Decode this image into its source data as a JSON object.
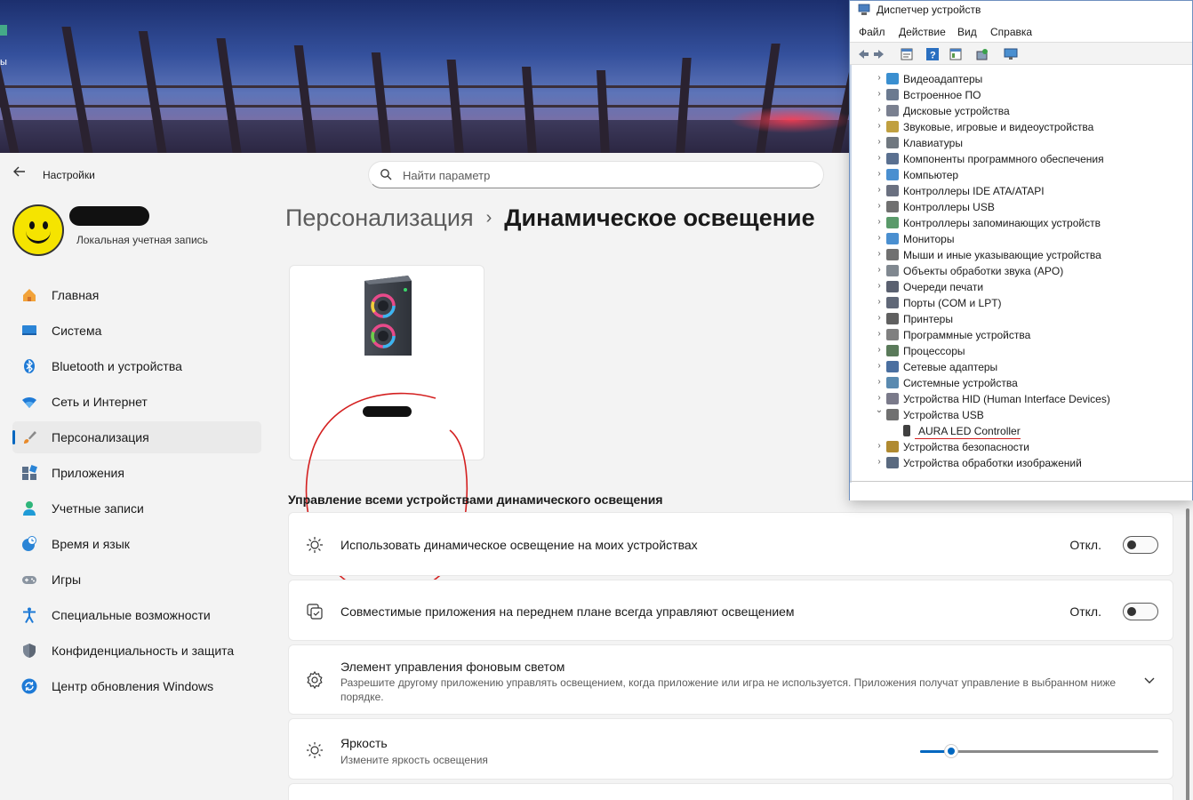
{
  "desktop": {
    "label_fragment": "ы"
  },
  "settings": {
    "title": "Настройки",
    "search": {
      "placeholder": "Найти параметр"
    },
    "account_type": "Локальная учетная запись",
    "nav": [
      {
        "label": "Главная",
        "icon": "home-icon"
      },
      {
        "label": "Система",
        "icon": "system-icon"
      },
      {
        "label": "Bluetooth и устройства",
        "icon": "bluetooth-icon"
      },
      {
        "label": "Сеть и Интернет",
        "icon": "wifi-icon"
      },
      {
        "label": "Персонализация",
        "icon": "brush-icon",
        "active": true
      },
      {
        "label": "Приложения",
        "icon": "apps-icon"
      },
      {
        "label": "Учетные записи",
        "icon": "account-icon"
      },
      {
        "label": "Время и язык",
        "icon": "clock-globe-icon"
      },
      {
        "label": "Игры",
        "icon": "gamepad-icon"
      },
      {
        "label": "Специальные возможности",
        "icon": "accessibility-icon"
      },
      {
        "label": "Конфиденциальность и защита",
        "icon": "shield-icon"
      },
      {
        "label": "Центр обновления Windows",
        "icon": "update-icon"
      }
    ],
    "breadcrumb": {
      "parent": "Персонализация",
      "separator": "›",
      "current": "Динамическое освещение"
    },
    "section_title": "Управление всеми устройствами динамического освещения",
    "rows": {
      "use_dynamic": {
        "title": "Использовать динамическое освещение на моих устройствах",
        "state": "Откл.",
        "on": false
      },
      "foreground_apps": {
        "title": "Совместимые приложения на переднем плане всегда управляют освещением",
        "state": "Откл.",
        "on": false
      },
      "background_control": {
        "title": "Элемент управления фоновым светом",
        "desc": "Разрешите другому приложению управлять освещением, когда приложение или игра не используется. Приложения получат управление в выбранном ниже порядке."
      },
      "brightness": {
        "title": "Яркость",
        "desc": "Измените яркость освещения",
        "value_fraction": 0.13
      }
    },
    "colors": {
      "accent": "#0067c0",
      "annotation": "#d42020"
    }
  },
  "device_manager": {
    "title": "Диспетчер устройств",
    "menu": [
      "Файл",
      "Действие",
      "Вид",
      "Справка"
    ],
    "toolbar": [
      "back-icon",
      "forward-icon",
      "properties-icon",
      "help-icon",
      "view-icon",
      "scan-hardware-icon",
      "monitor-icon"
    ],
    "tree": [
      {
        "label": "Видеоадаптеры",
        "expanded": false
      },
      {
        "label": "Встроенное ПО",
        "expanded": false
      },
      {
        "label": "Дисковые устройства",
        "expanded": false
      },
      {
        "label": "Звуковые, игровые и видеоустройства",
        "expanded": false
      },
      {
        "label": "Клавиатуры",
        "expanded": false
      },
      {
        "label": "Компоненты программного обеспечения",
        "expanded": false
      },
      {
        "label": "Компьютер",
        "expanded": false
      },
      {
        "label": "Контроллеры IDE ATA/ATAPI",
        "expanded": false
      },
      {
        "label": "Контроллеры USB",
        "expanded": false
      },
      {
        "label": "Контроллеры запоминающих устройств",
        "expanded": false
      },
      {
        "label": "Мониторы",
        "expanded": false
      },
      {
        "label": "Мыши и иные указывающие устройства",
        "expanded": false
      },
      {
        "label": "Объекты обработки звука (APO)",
        "expanded": false
      },
      {
        "label": "Очереди печати",
        "expanded": false
      },
      {
        "label": "Порты (COM и LPT)",
        "expanded": false
      },
      {
        "label": "Принтеры",
        "expanded": false
      },
      {
        "label": "Программные устройства",
        "expanded": false
      },
      {
        "label": "Процессоры",
        "expanded": false
      },
      {
        "label": "Сетевые адаптеры",
        "expanded": false
      },
      {
        "label": "Системные устройства",
        "expanded": false
      },
      {
        "label": "Устройства HID (Human Interface Devices)",
        "expanded": false
      },
      {
        "label": "Устройства USB",
        "expanded": true
      },
      {
        "label": "AURA LED Controller",
        "child": true,
        "underlined": true
      },
      {
        "label": "Устройства безопасности",
        "expanded": false
      },
      {
        "label": "Устройства обработки изображений",
        "expanded": false
      }
    ]
  }
}
